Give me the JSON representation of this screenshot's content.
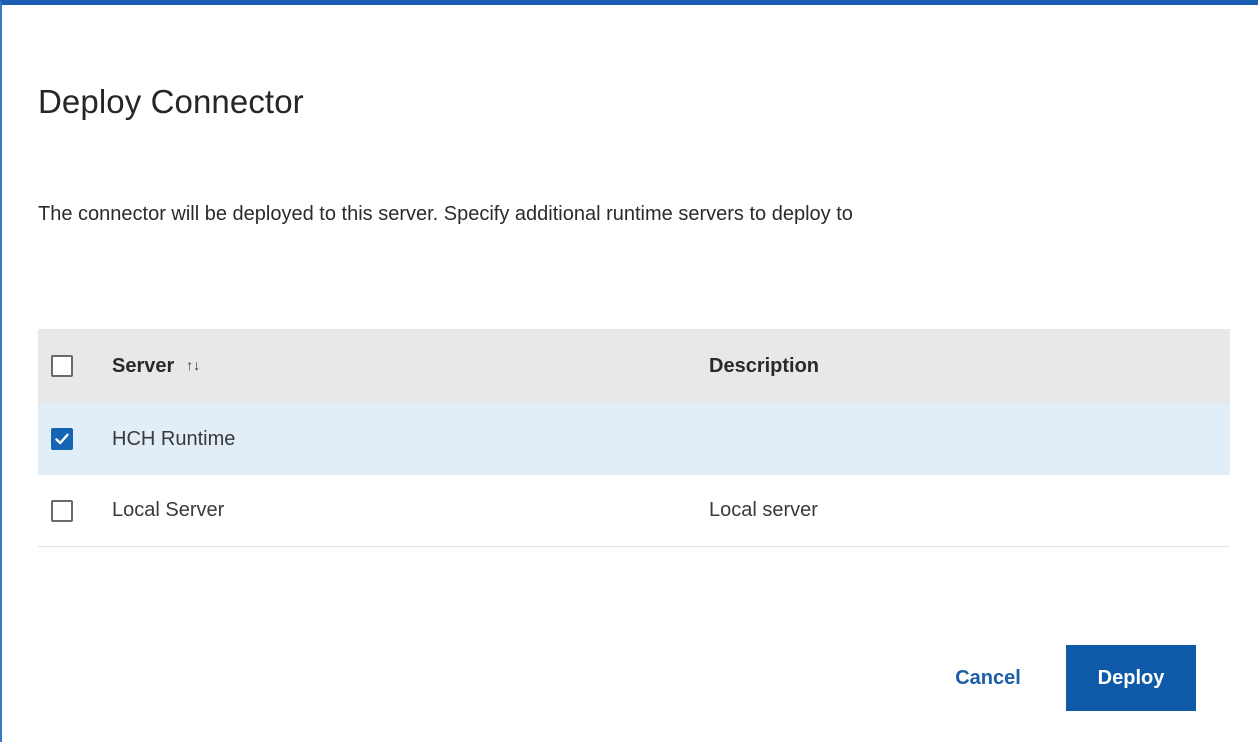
{
  "dialog": {
    "title": "Deploy Connector",
    "description": "The connector will be deployed to this server. Specify additional runtime servers to deploy to"
  },
  "table": {
    "columns": {
      "server": "Server",
      "sort_icon": "⇅",
      "description": "Description"
    },
    "select_all_checked": false,
    "rows": [
      {
        "server": "HCH Runtime",
        "description": "",
        "checked": true
      },
      {
        "server": "Local Server",
        "description": "Local server",
        "checked": false
      }
    ]
  },
  "buttons": {
    "cancel": "Cancel",
    "deploy": "Deploy"
  },
  "colors": {
    "accent": "#0f5aa8",
    "selected_row": "#e1eef8",
    "header_row": "#e8e8e8"
  },
  "icons": {
    "sort": "sort-icon",
    "check": "checkmark-icon"
  }
}
